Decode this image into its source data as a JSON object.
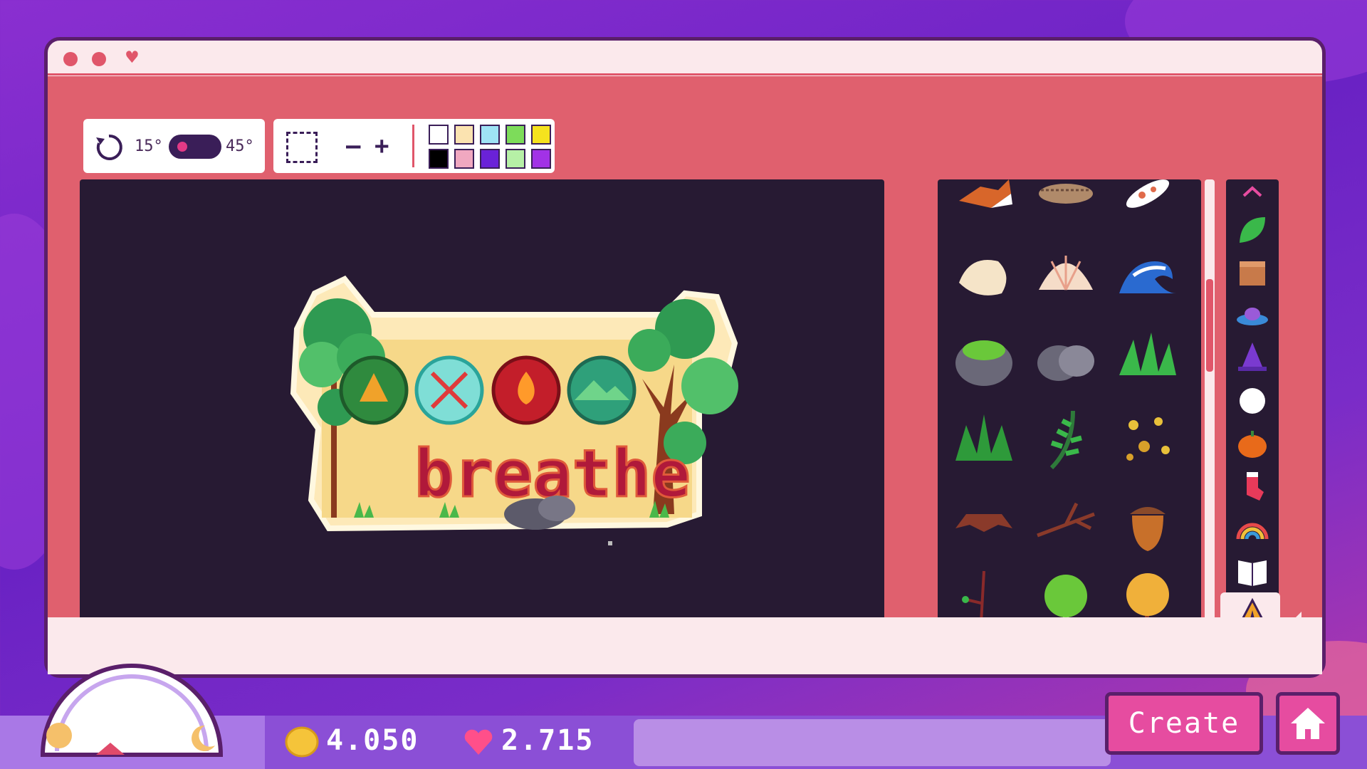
{
  "rotation": {
    "min_label": "15°",
    "max_label": "45°",
    "icon": "rotate-icon"
  },
  "selection": {
    "icon": "select-marquee-icon",
    "minus_label": "–",
    "plus_label": "+"
  },
  "palette_colors": {
    "top": [
      "#ffffff",
      "#fbe3b0",
      "#9fe3f5",
      "#7ddc5a",
      "#f5e21e"
    ],
    "bottom": [
      "#000000",
      "#f0a8c0",
      "#6a22d8",
      "#b6f0a6",
      "#a232e6"
    ]
  },
  "canvas": {
    "sticker_text": "breathe",
    "badges": [
      "tent-icon",
      "paddles-icon",
      "campfire-icon",
      "mountain-icon"
    ]
  },
  "items_panel": {
    "items": [
      "fox-icon",
      "hedgehog-icon",
      "koi-fish-icon",
      "seashell-icon",
      "scallop-shell-icon",
      "wave-icon",
      "mossy-rock-icon",
      "rocks-icon",
      "grass-tuft-icon",
      "grass-bush-icon",
      "fern-icon",
      "falling-leaves-icon",
      "tree-stump-icon",
      "twig-icon",
      "acorn-icon",
      "branch-icon",
      "birch-tree-icon",
      "autumn-tree-icon"
    ]
  },
  "categories": [
    "leaf-icon",
    "box-icon",
    "ufo-icon",
    "witch-hat-icon",
    "circle-icon",
    "pumpkin-icon",
    "stocking-icon",
    "rainbow-icon",
    "book-icon",
    "tent-icon"
  ],
  "selected_category": "tent-icon",
  "hud": {
    "coins": "4.050",
    "hearts": "2.715",
    "create_label": "Create"
  },
  "colors": {
    "accent": "#e64ca0",
    "panel": "#e0606e",
    "canvas_bg": "#271a33"
  }
}
